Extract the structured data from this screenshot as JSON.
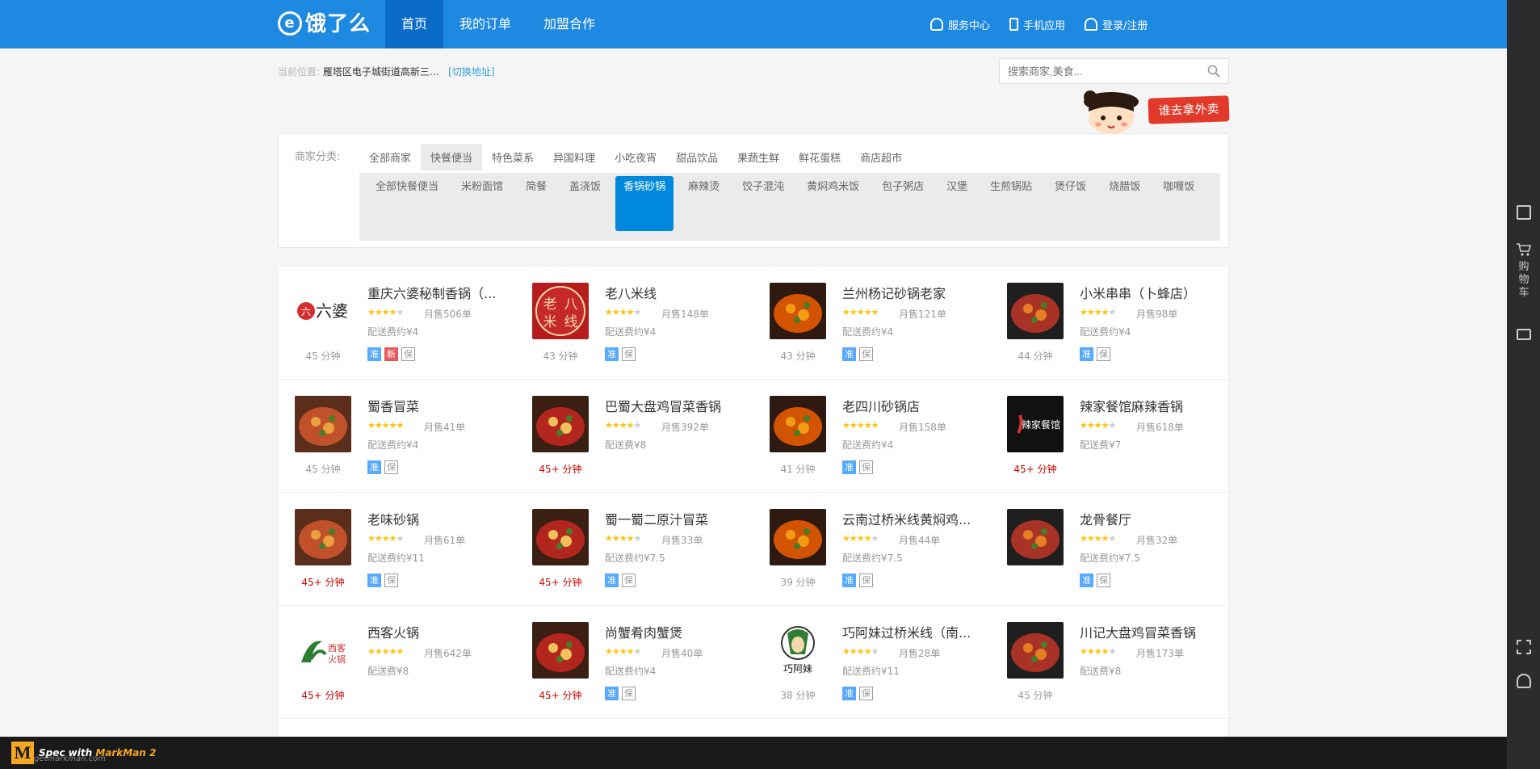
{
  "header": {
    "logo_text": "饿了么",
    "logo_mark": "e",
    "nav": [
      {
        "label": "首页"
      },
      {
        "label": "我的订单"
      },
      {
        "label": "加盟合作"
      }
    ],
    "service": "服务中心",
    "mobile": "手机应用",
    "login": "登录/注册"
  },
  "location": {
    "label": "当前位置:",
    "address": "雁塔区电子城街道高新三...",
    "change": "[切换地址]"
  },
  "search": {
    "placeholder": "搜索商家,美食..."
  },
  "promo": {
    "button": "谁去拿外卖"
  },
  "category": {
    "label": "商家分类:",
    "top": [
      "全部商家",
      "快餐便当",
      "特色菜系",
      "异国料理",
      "小吃夜宵",
      "甜品饮品",
      "果蔬生鲜",
      "鲜花蛋糕",
      "商店超市"
    ],
    "sub": [
      "全部快餐便当",
      "米粉面馆",
      "简餐",
      "盖浇饭",
      "香锅砂锅",
      "麻辣烫",
      "饺子混沌",
      "黄焖鸡米饭",
      "包子粥店",
      "汉堡",
      "生煎锅贴",
      "煲仔饭",
      "烧腊饭",
      "咖喱饭"
    ]
  },
  "colors": {
    "header_blue": "#1e89e0",
    "accent": "#0089dc",
    "star": "#ffc30c",
    "red_time": "#cc0000",
    "tag_blue": "#57a9ff",
    "tag_red": "#e75959"
  },
  "shops": [
    {
      "name": "重庆六婆秘制香锅（...",
      "rating": 4,
      "sold": "月售506单",
      "fee": "配送费约¥4",
      "time": "45 分钟",
      "time_red": false,
      "tags": [
        "准",
        "新",
        "保"
      ],
      "thumb": "logo-liupo"
    },
    {
      "name": "老八米线",
      "rating": 4,
      "sold": "月售148单",
      "fee": "配送费约¥4",
      "time": "43 分钟",
      "time_red": false,
      "tags": [
        "准",
        "保"
      ],
      "thumb": "logo-laoba"
    },
    {
      "name": "兰州杨记砂锅老家",
      "rating": 4.5,
      "sold": "月售121单",
      "fee": "配送费约¥4",
      "time": "43 分钟",
      "time_red": false,
      "tags": [
        "准",
        "保"
      ],
      "thumb": "food"
    },
    {
      "name": "小米串串（卜蜂店）",
      "rating": 4,
      "sold": "月售98单",
      "fee": "配送费约¥4",
      "time": "44 分钟",
      "time_red": false,
      "tags": [
        "准",
        "保"
      ],
      "thumb": "food"
    },
    {
      "name": "蜀香冒菜",
      "rating": 5,
      "sold": "月售41单",
      "fee": "配送费约¥4",
      "time": "45 分钟",
      "time_red": false,
      "tags": [
        "准",
        "保"
      ],
      "thumb": "food"
    },
    {
      "name": "巴蜀大盘鸡冒菜香锅",
      "rating": 3.5,
      "sold": "月售392单",
      "fee": "配送费¥8",
      "time": "45+ 分钟",
      "time_red": true,
      "tags": [],
      "thumb": "food"
    },
    {
      "name": "老四川砂锅店",
      "rating": 5,
      "sold": "月售158单",
      "fee": "配送费约¥4",
      "time": "41 分钟",
      "time_red": false,
      "tags": [
        "准",
        "保"
      ],
      "thumb": "food"
    },
    {
      "name": "辣家餐馆麻辣香锅",
      "rating": 4,
      "sold": "月售618单",
      "fee": "配送费¥7",
      "time": "45+ 分钟",
      "time_red": true,
      "tags": [],
      "thumb": "logo-lajia"
    },
    {
      "name": "老味砂锅",
      "rating": 4,
      "sold": "月售61单",
      "fee": "配送费约¥11",
      "time": "45+ 分钟",
      "time_red": true,
      "tags": [
        "准",
        "保"
      ],
      "thumb": "food"
    },
    {
      "name": "蜀一蜀二原汁冒菜",
      "rating": 4,
      "sold": "月售33单",
      "fee": "配送费约¥7.5",
      "time": "45+ 分钟",
      "time_red": true,
      "tags": [
        "准",
        "保"
      ],
      "thumb": "food"
    },
    {
      "name": "云南过桥米线黄焖鸡...",
      "rating": 4,
      "sold": "月售44单",
      "fee": "配送费约¥7.5",
      "time": "39 分钟",
      "time_red": false,
      "tags": [
        "准",
        "保"
      ],
      "thumb": "food"
    },
    {
      "name": "龙骨餐厅",
      "rating": 4,
      "sold": "月售32单",
      "fee": "配送费约¥7.5",
      "time": "",
      "time_red": false,
      "tags": [
        "准",
        "保"
      ],
      "thumb": "food"
    },
    {
      "name": "西客火锅",
      "rating": 5,
      "sold": "月售642单",
      "fee": "配送费¥8",
      "time": "45+ 分钟",
      "time_red": true,
      "tags": [],
      "thumb": "logo-xike"
    },
    {
      "name": "尚蟹肴肉蟹煲",
      "rating": 3.5,
      "sold": "月售40单",
      "fee": "配送费约¥4",
      "time": "45+ 分钟",
      "time_red": true,
      "tags": [
        "准",
        "保"
      ],
      "thumb": "food"
    },
    {
      "name": "巧阿妹过桥米线（南...",
      "rating": 4,
      "sold": "月售28单",
      "fee": "配送费约¥11",
      "time": "38 分钟",
      "time_red": false,
      "tags": [
        "准",
        "保"
      ],
      "thumb": "logo-qiaoamei"
    },
    {
      "name": "川记大盘鸡冒菜香锅",
      "rating": 4,
      "sold": "月售173单",
      "fee": "配送费¥8",
      "time": "45 分钟",
      "time_red": false,
      "tags": [],
      "thumb": "food"
    }
  ],
  "sidebar": {
    "cart_label": "购物车"
  },
  "footer": {
    "brand_m": "M",
    "spec_text": "Spec with",
    "spec_brand": "MarkMan 2",
    "site": "getmarkman.com"
  }
}
